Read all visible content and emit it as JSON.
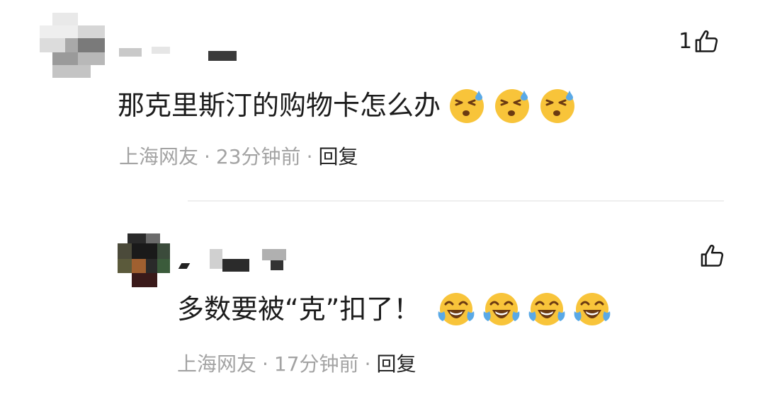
{
  "comments": [
    {
      "text": "那克里斯汀的购物卡怎么办",
      "emoji_name": "sweat-smile-emoji",
      "emoji_count": 3,
      "location": "上海网友",
      "time": "23分钟前",
      "reply_label": "回复",
      "likes": "1"
    },
    {
      "text": "多数要被“克”扣了！",
      "emoji_name": "laughing-tears-emoji",
      "emoji_count": 4,
      "location": "上海网友",
      "time": "17分钟前",
      "reply_label": "回复",
      "likes": ""
    }
  ],
  "colors": {
    "meta": "#a3a3a3",
    "text": "#1c1c1c",
    "divider": "#eeeeee",
    "emoji_face": "#f8c43a",
    "emoji_tear": "#5aa9e6"
  },
  "icons": {
    "like": "thumbs-up-outline-icon"
  },
  "separator": "·"
}
